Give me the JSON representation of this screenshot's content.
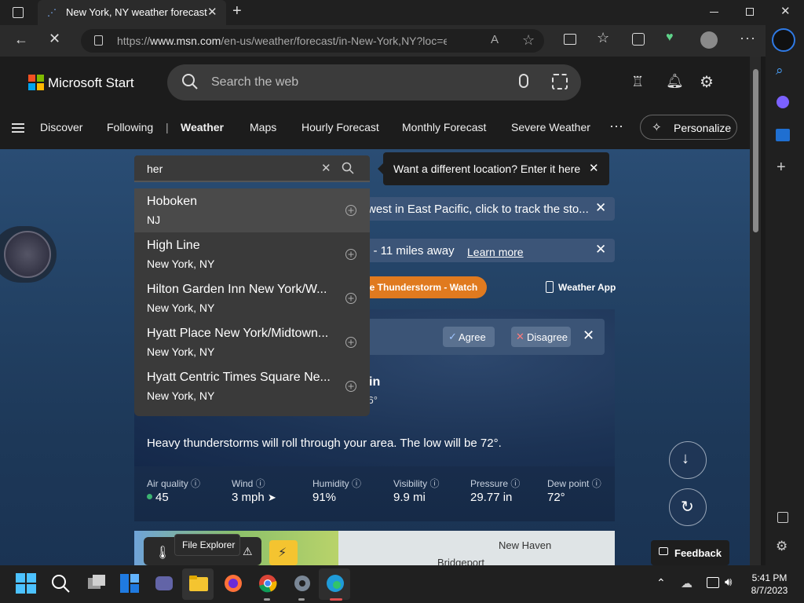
{
  "browser": {
    "tab_title": "New York, NY weather forecast | ",
    "url_prefix": "https://",
    "url_domain": "www.msn.com",
    "url_rest": "/en-us/weather/forecast/in-New-York,NY?loc=eyJsI..."
  },
  "header": {
    "logo": "Microsoft Start",
    "search_placeholder": "Search the web"
  },
  "nav": {
    "items": [
      "Discover",
      "Following",
      "Weather",
      "Maps",
      "Hourly Forecast",
      "Monthly Forecast",
      "Severe Weather"
    ],
    "separator": "|",
    "personalize": "Personalize"
  },
  "location_search": {
    "query": "her",
    "tooltip": "Want a different location? Enter it here",
    "results": [
      {
        "name": "Hoboken",
        "sub": "NJ"
      },
      {
        "name": "High Line",
        "sub": "New York, NY"
      },
      {
        "name": "Hilton Garden Inn New York/W...",
        "sub": "New York, NY"
      },
      {
        "name": "Hyatt Place New York/Midtown...",
        "sub": "New York, NY"
      },
      {
        "name": "Hyatt Centric Times Square Ne...",
        "sub": "New York, NY"
      }
    ]
  },
  "banners": {
    "storm": "west in East Pacific, click to track the sto...",
    "lightning": "l - 11 miles away",
    "lightning_link": "Learn more",
    "watch": "re Thunderstorm - Watch",
    "weather_app": "Weather App"
  },
  "consent": {
    "agree": "Agree",
    "disagree": "Disagree"
  },
  "card": {
    "partial_in": "in",
    "partial_deg": "'6°",
    "description": "Heavy thunderstorms will roll through your area. The low will be 72°.",
    "stats": [
      {
        "label": "Air quality",
        "value": "45"
      },
      {
        "label": "Wind",
        "value": "3 mph"
      },
      {
        "label": "Humidity",
        "value": "91%"
      },
      {
        "label": "Visibility",
        "value": "9.9 mi"
      },
      {
        "label": "Pressure",
        "value": "29.77 in"
      },
      {
        "label": "Dew point",
        "value": "72°"
      }
    ],
    "air_quality_color": "#3cb371"
  },
  "map": {
    "labels": [
      "New Haven",
      "Bridgeport"
    ]
  },
  "feedback": "Feedback",
  "taskbar": {
    "tooltip": "File Explorer",
    "time": "5:41 PM",
    "date": "8/7/2023"
  },
  "colors": {
    "accent_orange": "#e07a1f",
    "edge_blue": "#3b82f6"
  }
}
